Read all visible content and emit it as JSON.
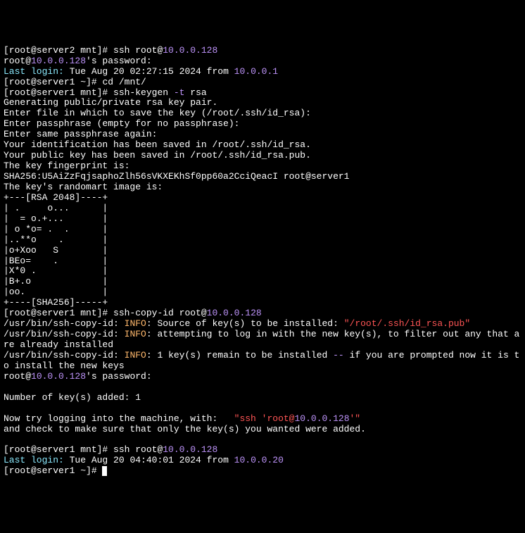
{
  "l1": {
    "p1": "[root@server2 mnt]# ",
    "p2": "ssh root@",
    "ip": "10.0.0.128"
  },
  "l2": {
    "p1": "root@",
    "ip": "10.0.0.128",
    "p2": "'s password:"
  },
  "l3": {
    "p1": "Last login:",
    "p2": " Tue Aug 20 02:27:15 2024 from ",
    "ip": "10.0.0.1"
  },
  "l4": {
    "p1": "[root@server1 ~]# ",
    "p2": "cd /mnt/"
  },
  "l5": {
    "p1": "[root@server1 mnt]# ",
    "p2": "ssh-keygen ",
    "flag": "-t",
    "p3": " rsa"
  },
  "l6": "Generating public/private rsa key pair.",
  "l7": "Enter file in which to save the key (/root/.ssh/id_rsa):",
  "l8": "Enter passphrase (empty for no passphrase):",
  "l9": "Enter same passphrase again:",
  "l10": "Your identification has been saved in /root/.ssh/id_rsa.",
  "l11": "Your public key has been saved in /root/.ssh/id_rsa.pub.",
  "l12": "The key fingerprint is:",
  "l13": "SHA256:U5AiZzFqjsaphoZlh56sVKXEKhSf0pp60a2CciQeacI root@server1",
  "l14": "The key's randomart image is:",
  "art1": "+---[RSA 2048]----+",
  "art2": "| .     o...      |",
  "art3": "|  = o.+...       |",
  "art4": "| o *o= .  .      |",
  "art5": "|..**o    .       |",
  "art6": "|o+Xoo   S        |",
  "art7": "|BEo=    .        |",
  "art8": "|X*0 .            |",
  "art9": "|B+.o             |",
  "art10": "|oo.              |",
  "art11": "+----[SHA256]-----+",
  "l15": {
    "p1": "[root@server1 mnt]# ",
    "p2": "ssh-copy-id root@",
    "ip": "10.0.0.128"
  },
  "l16": {
    "p1": "/usr/bin/ssh-copy-id: ",
    "info": "INFO",
    "p2": ": Source of key(s) to be installed: ",
    "str": "\"/root/.ssh/id_rsa.pub\""
  },
  "l17": {
    "p1": "/usr/bin/ssh-copy-id: ",
    "info": "INFO",
    "p2": ": attempting to log in with the new key(s), to filter out any that are already installed"
  },
  "l18": {
    "p1": "/usr/bin/ssh-copy-id: ",
    "info": "INFO",
    "p2": ": 1 key(s) remain to be installed ",
    "dash": "--",
    "p3": " if you are prompted now it is to install the new keys"
  },
  "l19": {
    "p1": "root@",
    "ip": "10.0.0.128",
    "p2": "'s password:"
  },
  "blank": "",
  "l20": "Number of key(s) added: 1",
  "l21": {
    "p1": "Now try logging into the machine, with:   ",
    "q1": "\"ssh '",
    "user": "root@",
    "ip": "10.0.0.128",
    "q2": "'\""
  },
  "l22": "and check to make sure that only the key(s) you wanted were added.",
  "l23": {
    "p1": "[root@server1 mnt]# ",
    "p2": "ssh root@",
    "ip": "10.0.0.128"
  },
  "l24": {
    "p1": "Last login:",
    "p2": " Tue Aug 20 04:40:01 2024 from ",
    "ip": "10.0.0.20"
  },
  "l25": {
    "p1": "[root@server1 ~]# "
  }
}
